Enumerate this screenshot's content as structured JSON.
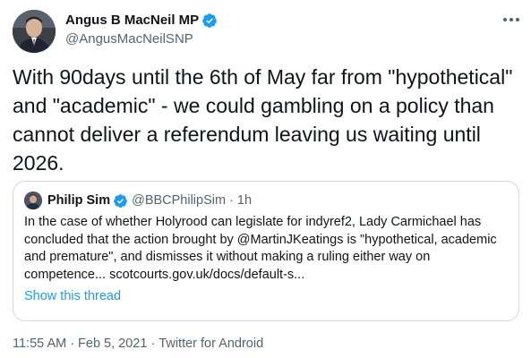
{
  "author": {
    "name": "Angus B MacNeil MP",
    "handle": "@AngusMacNeilSNP"
  },
  "tweet": {
    "text": "With 90days until the 6th of May far from \"hypothetical\" and \"academic\" - we could gambling on a policy than cannot deliver a referendum leaving us waiting until 2026."
  },
  "quoted": {
    "name": "Philip Sim",
    "handle": "@BBCPhilipSim",
    "separator": "·",
    "time": "1h",
    "text": "In the case of whether Holyrood can legislate for indyref2, Lady Carmichael has concluded that the action brought by @MartinJKeatings is \"hypothetical, academic and premature\", and dismisses it without making a ruling either way on competence... scotcourts.gov.uk/docs/default-s...",
    "show_thread": "Show this thread"
  },
  "meta": {
    "time": "11:55 AM",
    "date": "Feb 5, 2021",
    "source": "Twitter for Android",
    "separator": "·"
  },
  "icons": {
    "verified": "verified-badge-icon",
    "more": "more-options-icon"
  },
  "colors": {
    "accent": "#1d9bf0",
    "secondary_text": "#536471",
    "border": "#cfd9de"
  }
}
